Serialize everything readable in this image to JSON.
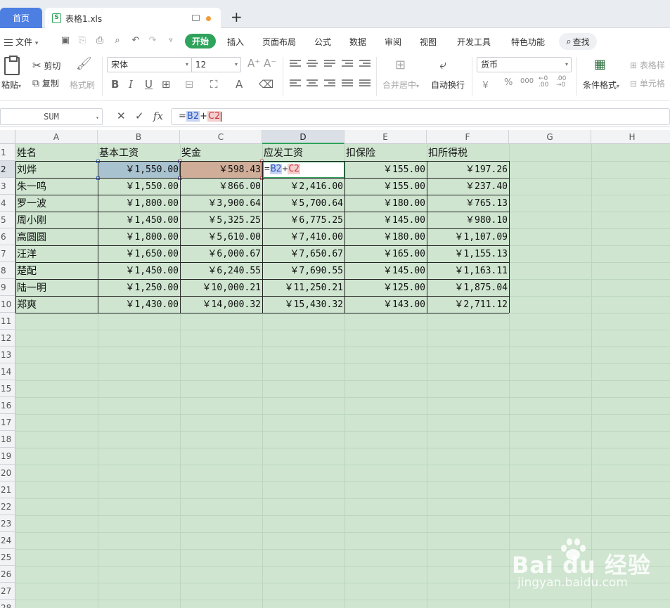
{
  "tabs": {
    "home": "首页",
    "file": "表格1.xls"
  },
  "menu": {
    "file": "文件",
    "items": [
      "开始",
      "插入",
      "页面布局",
      "公式",
      "数据",
      "审阅",
      "视图",
      "开发工具",
      "特色功能"
    ],
    "find": "查找"
  },
  "ribbon": {
    "paste": "粘贴",
    "cut": "剪切",
    "copy": "复制",
    "format_painter": "格式刷",
    "font_name": "宋体",
    "font_size": "12",
    "merge_center": "合并居中",
    "wrap_text": "自动换行",
    "number_format": "货币",
    "conditional_format": "条件格式",
    "table_style": "表格样",
    "cell_style": "单元格"
  },
  "formula_bar": {
    "name_box": "SUM",
    "fx": "fx",
    "formula_parts": [
      "=",
      "B2",
      "+",
      "C2"
    ]
  },
  "sheet": {
    "columns": [
      "A",
      "B",
      "C",
      "D",
      "E",
      "F",
      "G",
      "H"
    ],
    "rows": [
      "1",
      "2",
      "3",
      "4",
      "5",
      "6",
      "7",
      "8",
      "9",
      "10",
      "11",
      "12",
      "13",
      "14",
      "15",
      "16",
      "17",
      "18",
      "19",
      "20",
      "21",
      "22",
      "23",
      "24",
      "25",
      "26",
      "27",
      "28"
    ],
    "headers": [
      "姓名",
      "基本工资",
      "奖金",
      "应发工资",
      "扣保险",
      "扣所得税"
    ],
    "data": [
      [
        "刘烨",
        "￥1,550.00",
        "￥598.43",
        "=B2+C2",
        "￥155.00",
        "￥197.26"
      ],
      [
        "朱一鸣",
        "￥1,550.00",
        "￥866.00",
        "￥2,416.00",
        "￥155.00",
        "￥237.40"
      ],
      [
        "罗一波",
        "￥1,800.00",
        "￥3,900.64",
        "￥5,700.64",
        "￥180.00",
        "￥765.13"
      ],
      [
        "周小刚",
        "￥1,450.00",
        "￥5,325.25",
        "￥6,775.25",
        "￥145.00",
        "￥980.10"
      ],
      [
        "高圆圆",
        "￥1,800.00",
        "￥5,610.00",
        "￥7,410.00",
        "￥180.00",
        "￥1,107.09"
      ],
      [
        "汪洋",
        "￥1,650.00",
        "￥6,000.67",
        "￥7,650.67",
        "￥165.00",
        "￥1,155.13"
      ],
      [
        "楚配",
        "￥1,450.00",
        "￥6,240.55",
        "￥7,690.55",
        "￥145.00",
        "￥1,163.11"
      ],
      [
        "陆一明",
        "￥1,250.00",
        "￥10,000.21",
        "￥11,250.21",
        "￥125.00",
        "￥1,875.04"
      ],
      [
        "郑爽",
        "￥1,430.00",
        "￥14,000.32",
        "￥15,430.32",
        "￥143.00",
        "￥2,711.12"
      ]
    ]
  },
  "watermark": {
    "logo": "Bai du 经验",
    "url": "jingyan.baidu.com"
  }
}
